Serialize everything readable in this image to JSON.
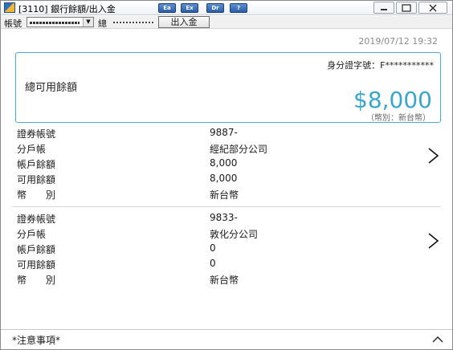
{
  "window": {
    "title": "[3110] 銀行餘額/出入金",
    "toolbar_buttons": [
      "Ea",
      "Ex",
      "Dr",
      "?"
    ]
  },
  "account_bar": {
    "account_label": "帳號",
    "name_label": "總",
    "in_out_button": "出入金"
  },
  "timestamp": "2019/07/12 19:32",
  "summary": {
    "id_line": "身分證字號：F***********",
    "total_label": "總可用餘額",
    "total_amount": "$8,000",
    "currency_note": "（幣別：新台幣）"
  },
  "accounts": [
    {
      "rows": [
        {
          "key": "證券帳號",
          "value": "9887-"
        },
        {
          "key": "分戶帳",
          "value": "經紀部分公司"
        },
        {
          "key": "帳戶餘額",
          "value": "8,000"
        },
        {
          "key": "可用餘額",
          "value": "8,000"
        },
        {
          "key": "幣別",
          "value": "新台幣"
        }
      ]
    },
    {
      "rows": [
        {
          "key": "證券帳號",
          "value": "9833-"
        },
        {
          "key": "分戶帳",
          "value": "敦化分公司"
        },
        {
          "key": "帳戶餘額",
          "value": "0"
        },
        {
          "key": "可用餘額",
          "value": "0"
        },
        {
          "key": "幣別",
          "value": "新台幣"
        }
      ]
    }
  ],
  "notes": {
    "label": "*注意事項*"
  },
  "colors": {
    "accent": "#3aa6cf",
    "card_border": "#4fa9cf"
  }
}
